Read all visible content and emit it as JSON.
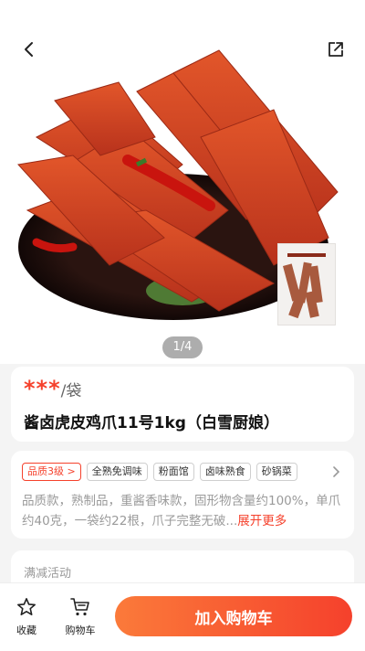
{
  "gallery": {
    "page_indicator": "1/4",
    "pack_label": "酱卤虎皮鸡爪"
  },
  "product": {
    "price": "***",
    "unit": "/袋",
    "title": "酱卤虎皮鸡爪11号1kg（白雪厨娘）"
  },
  "info": {
    "tags": [
      "品质3级 >",
      "全熟免调味",
      "粉面馆",
      "卤味熟食",
      "砂锅菜"
    ],
    "description": "品质款，熟制品，重酱香味款，固形物含量约100%，单爪约40克，一袋约22根，爪子完整无破...",
    "expand_label": "展开更多"
  },
  "promo": {
    "label": "满减活动"
  },
  "bottom_bar": {
    "favorite_label": "收藏",
    "cart_label": "购物车",
    "add_to_cart_label": "加入购物车"
  },
  "colors": {
    "accent": "#f5412c",
    "button_gradient_start": "#fb7a3a",
    "button_gradient_end": "#f5412c"
  }
}
